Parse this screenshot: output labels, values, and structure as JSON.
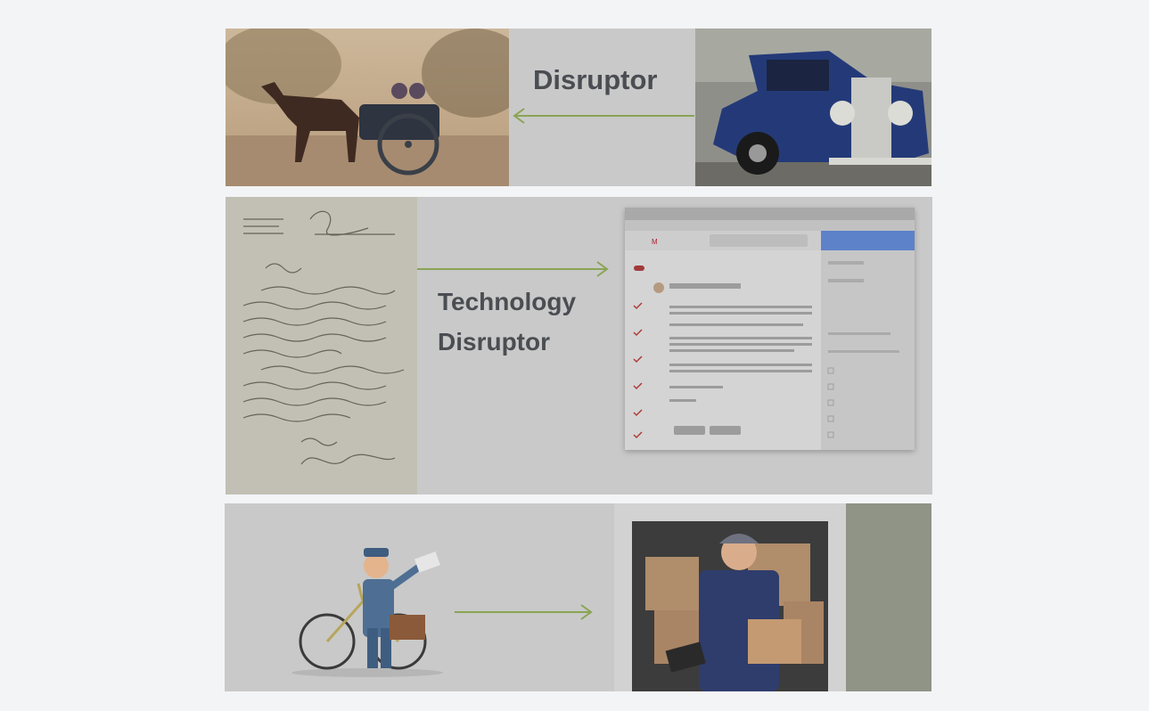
{
  "panels": [
    {
      "caption_lines": [
        "Disruptor"
      ],
      "left_image": "horse-carriage",
      "right_image": "vintage-blue-car",
      "arrow_direction": "left"
    },
    {
      "caption_lines": [
        "Technology",
        "Disruptor"
      ],
      "left_image": "handwritten-letter",
      "right_image": "email-client-screenshot",
      "arrow_direction": "right"
    },
    {
      "caption_lines": [],
      "left_image": "postman-on-bicycle",
      "right_image": "delivery-man-van",
      "arrow_direction": "right"
    }
  ],
  "colors": {
    "page_bg": "#f3f4f6",
    "panel_bg": "#c9c9c9",
    "arrow": "#8aa454",
    "caption_text": "#4a4d52"
  }
}
